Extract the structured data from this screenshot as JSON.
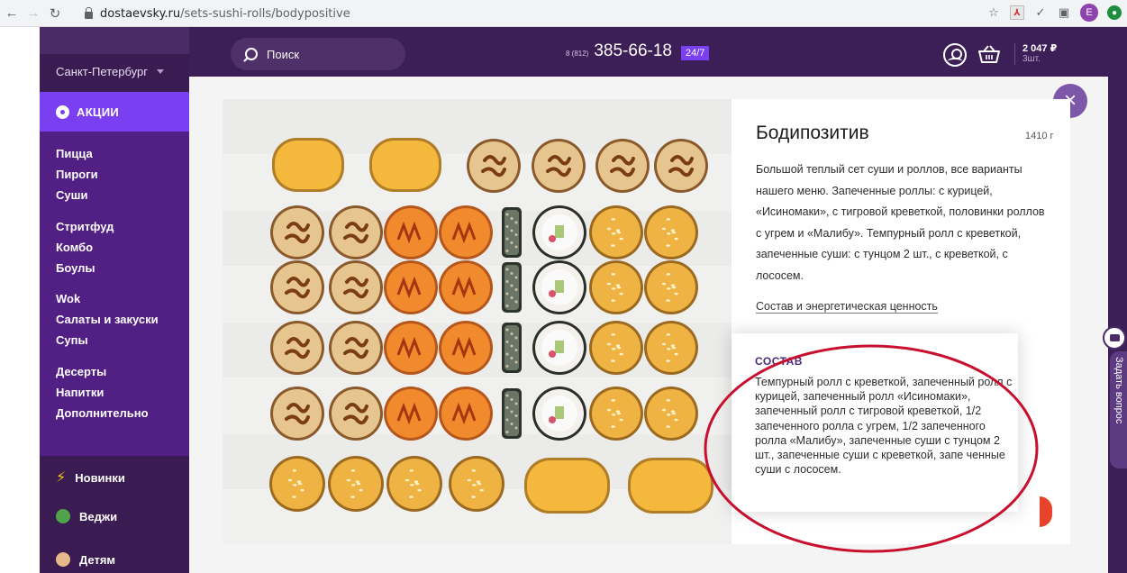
{
  "browser": {
    "url_domain": "dostaevsky.ru",
    "url_path": "/sets-sushi-rolls/bodypositive",
    "profile_letter": "E"
  },
  "sidebar": {
    "city": "Санкт-Петербург",
    "promo": "АКЦИИ",
    "items": [
      "Пицца",
      "Пироги",
      "Суши",
      "Стритфуд",
      "Комбо",
      "Боулы",
      "Wok",
      "Салаты и закуски",
      "Супы",
      "Десерты",
      "Напитки",
      "Дополнительно"
    ],
    "bottom": [
      "Новинки",
      "Веджи",
      "Детям"
    ]
  },
  "header": {
    "search_placeholder": "Поиск",
    "phone_prefix": "8 (812)",
    "phone_number": "385-66-18",
    "phone_badge": "24/7",
    "cart_sum": "2 047 ₽",
    "cart_count": "3шт."
  },
  "product": {
    "title": "Бодипозитив",
    "weight": "1410 г",
    "description": "Большой теплый сет суши и роллов, все варианты нашего меню. Запеченные роллы: с курицей, «Исиномаки», с тигровой креветкой, половинки роллов с угрем и «Малибу». Темпурный ролл с креветкой, запеченные суши: с тунцом 2 шт., с креветкой, с лососем.",
    "composition_link": "Состав и энергетическая ценность"
  },
  "tooltip": {
    "title": "СОСТАВ",
    "text": "Темпурный ролл с креветкой, запеченный ролл с курицей, запеченный ролл «Исиномаки», запеченный ролл с тигровой креветкой, 1/2 запеченного ролла с угрем, 1/2 запеченного ролла «Малибу», запеченные суши с тунцом 2 шт., запеченные суши с креветкой, запе ченные суши с лососем."
  },
  "chat": {
    "label": "Задать вопрос"
  },
  "colors": {
    "sidebar": "#3a1b52",
    "promo": "#7b3ff2",
    "menu_panel": "#521f85",
    "annotation": "#c8102e"
  }
}
